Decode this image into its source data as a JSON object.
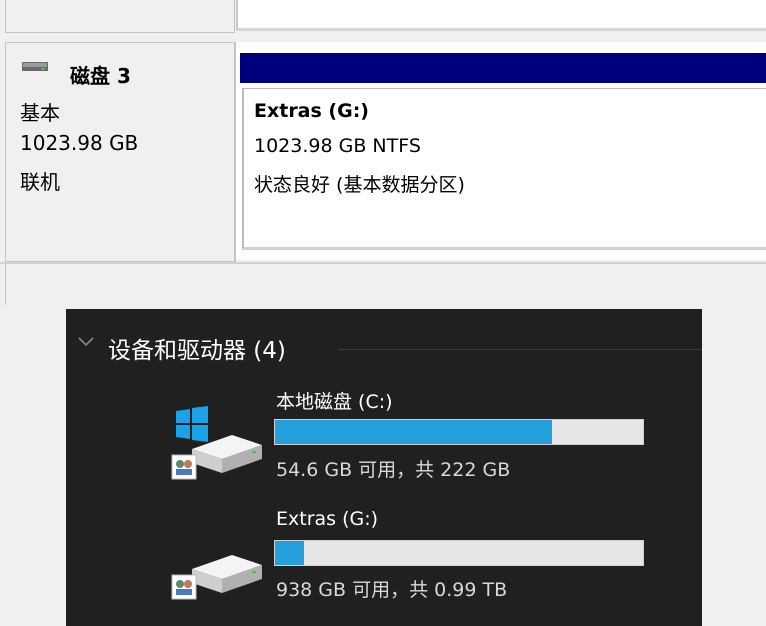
{
  "disk_management": {
    "disk": {
      "title": "磁盘 3",
      "type": "基本",
      "size": "1023.98 GB",
      "status": "联机"
    },
    "volume": {
      "name": "Extras  (G:)",
      "size_fs": "1023.98 GB NTFS",
      "health": "状态良好 (基本数据分区)",
      "bar_color": "#00007e"
    }
  },
  "explorer": {
    "group_title": "设备和驱动器 (4)",
    "drives": [
      {
        "name": "本地磁盘 (C:)",
        "free_text": "54.6 GB 可用，共 222 GB",
        "used_fraction": 0.754,
        "icon": "windows-system-drive-icon"
      },
      {
        "name": "Extras (G:)",
        "free_text": "938 GB 可用，共 0.99 TB",
        "used_fraction": 0.08,
        "icon": "hard-drive-icon"
      }
    ],
    "bar_fill_color": "#26a0da",
    "bar_track_color": "#e6e6e6"
  }
}
